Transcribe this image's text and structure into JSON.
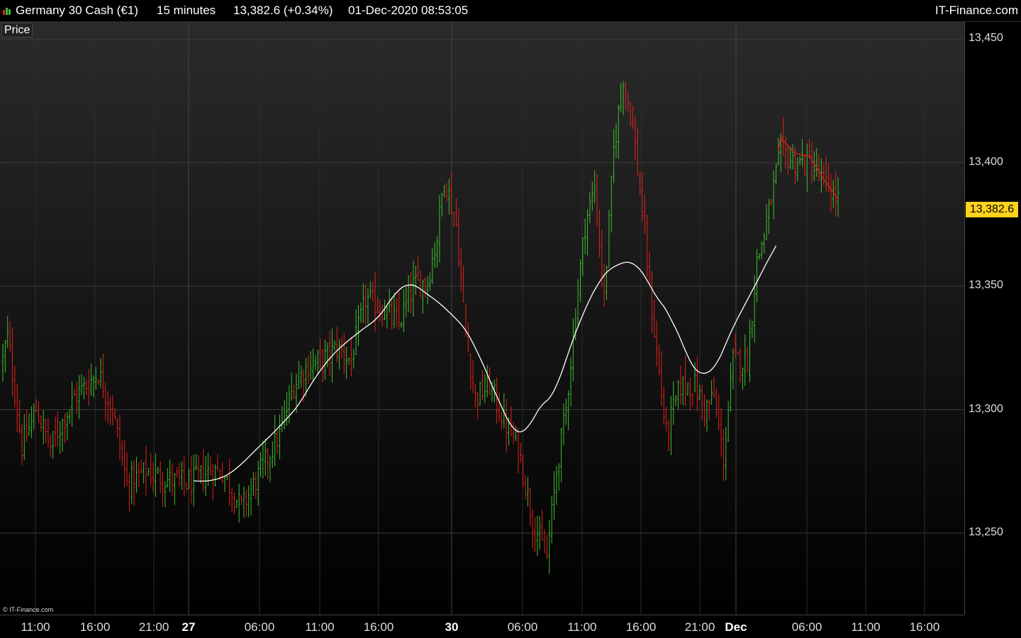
{
  "header": {
    "instrument": "Germany 30 Cash (€1)",
    "timeframe": "15 minutes",
    "quote": "13,382.6 (+0.34%)",
    "datetime": "01-Dec-2020 08:53:05",
    "brand": "IT-Finance.com"
  },
  "panel_label": "Price",
  "copyright": "© IT-Finance.com",
  "last_price_label": "13,382.6",
  "colors": {
    "up": "#3fbf2e",
    "down": "#e0221c",
    "ma": "#ffffff",
    "badge": "#ffd21f"
  },
  "chart_data": {
    "type": "ohlc",
    "x_ticks": [
      "11:00",
      "16:00",
      "21:00",
      "27",
      "06:00",
      "11:00",
      "16:00",
      "30",
      "06:00",
      "11:00",
      "16:00",
      "21:00",
      "Dec",
      "06:00",
      "11:00",
      "16:00"
    ],
    "x_tick_is_day": [
      false,
      false,
      false,
      true,
      false,
      false,
      false,
      true,
      false,
      false,
      false,
      false,
      true,
      false,
      false,
      false
    ],
    "y_ticks": [
      "13,450",
      "13,400",
      "13,350",
      "13,300",
      "13,250"
    ],
    "y_tick_values": [
      13450,
      13400,
      13350,
      13300,
      13250
    ],
    "ylim": [
      13217,
      13457
    ],
    "last_price": 13382.6,
    "price_anchors": [
      [
        0,
        13320
      ],
      [
        2,
        13330
      ],
      [
        8,
        13285
      ],
      [
        14,
        13300
      ],
      [
        20,
        13285
      ],
      [
        30,
        13305
      ],
      [
        40,
        13315
      ],
      [
        46,
        13300
      ],
      [
        52,
        13270
      ],
      [
        60,
        13275
      ],
      [
        68,
        13272
      ],
      [
        78,
        13270
      ],
      [
        86,
        13275
      ],
      [
        92,
        13275
      ],
      [
        100,
        13260
      ],
      [
        108,
        13275
      ],
      [
        116,
        13290
      ],
      [
        122,
        13310
      ],
      [
        128,
        13318
      ],
      [
        134,
        13320
      ],
      [
        140,
        13325
      ],
      [
        146,
        13320
      ],
      [
        152,
        13345
      ],
      [
        160,
        13340
      ],
      [
        166,
        13335
      ],
      [
        172,
        13350
      ],
      [
        178,
        13352
      ],
      [
        182,
        13370
      ],
      [
        185,
        13395
      ],
      [
        190,
        13375
      ],
      [
        194,
        13330
      ],
      [
        198,
        13305
      ],
      [
        204,
        13310
      ],
      [
        210,
        13295
      ],
      [
        216,
        13285
      ],
      [
        222,
        13255
      ],
      [
        228,
        13240
      ],
      [
        232,
        13275
      ],
      [
        236,
        13300
      ],
      [
        240,
        13340
      ],
      [
        244,
        13375
      ],
      [
        248,
        13390
      ],
      [
        252,
        13345
      ],
      [
        256,
        13405
      ],
      [
        260,
        13435
      ],
      [
        264,
        13415
      ],
      [
        268,
        13380
      ],
      [
        272,
        13340
      ],
      [
        278,
        13290
      ],
      [
        284,
        13310
      ],
      [
        290,
        13310
      ],
      [
        294,
        13300
      ],
      [
        298,
        13305
      ],
      [
        302,
        13280
      ],
      [
        306,
        13320
      ],
      [
        312,
        13320
      ],
      [
        316,
        13360
      ],
      [
        320,
        13375
      ],
      [
        326,
        13405
      ],
      [
        332,
        13400
      ],
      [
        338,
        13400
      ],
      [
        344,
        13392
      ],
      [
        350,
        13385
      ]
    ],
    "candle_count": 351,
    "ma_window": 24
  }
}
